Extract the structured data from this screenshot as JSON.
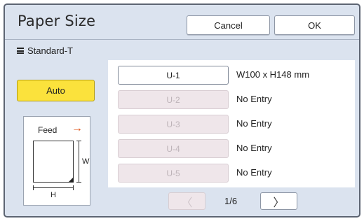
{
  "header": {
    "title": "Paper Size",
    "cancel_label": "Cancel",
    "ok_label": "OK"
  },
  "tray": {
    "icon": "list-icon",
    "name": "Standard-T"
  },
  "auto_label": "Auto",
  "diagram": {
    "feed_label": "Feed",
    "arrow": "→",
    "w_label": "W",
    "h_label": "H",
    "arrow_color": "#e2571c"
  },
  "entries": [
    {
      "slot": "U-1",
      "value": "W100 x H148 mm",
      "enabled": true
    },
    {
      "slot": "U-2",
      "value": "No Entry",
      "enabled": false
    },
    {
      "slot": "U-3",
      "value": "No Entry",
      "enabled": false
    },
    {
      "slot": "U-4",
      "value": "No Entry",
      "enabled": false
    },
    {
      "slot": "U-5",
      "value": "No Entry",
      "enabled": false
    }
  ],
  "pager": {
    "prev_icon": "chevron-left-icon",
    "prev_glyph": "〈",
    "next_icon": "chevron-right-icon",
    "next_glyph": "〉",
    "page_indicator": "1/6"
  },
  "colors": {
    "auto_button": "#fbe23c",
    "background": "#dbe3ef",
    "disabled_slot": "#efe6ea"
  }
}
